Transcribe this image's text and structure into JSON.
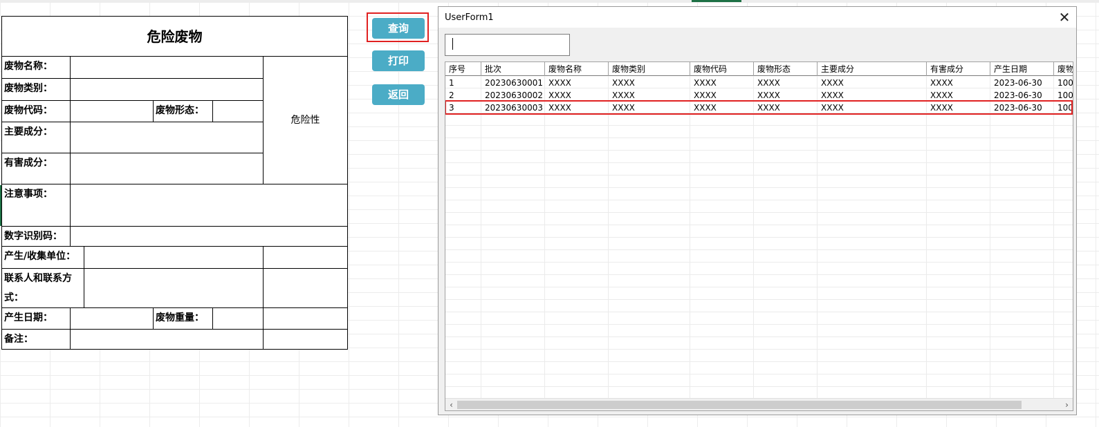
{
  "label_form": {
    "title": "危险废物",
    "rows": {
      "name_label": "废物名称：",
      "category_label": "废物类别：",
      "code_label": "废物代码：",
      "form_label": "废物形态：",
      "main_component_label": "主要成分：",
      "harmful_component_label": "有害成分：",
      "hazard_label": "危险性",
      "notes_label": "注意事项：",
      "digital_id_label": "数字识别码：",
      "producer_label": "产生/收集单位：",
      "contact_label": "联系人和联系方式：",
      "date_label": "产生日期：",
      "weight_label": "废物重量：",
      "remark_label": "备注："
    }
  },
  "buttons": {
    "query": "查询",
    "print": "打印",
    "back": "返回",
    "highlight_color": "#e02020",
    "button_color": "#4bacc6"
  },
  "userform": {
    "title": "UserForm1",
    "close_symbol": "✕",
    "search_value": "",
    "columns": [
      "序号",
      "批次",
      "废物名称",
      "废物类别",
      "废物代码",
      "废物形态",
      "主要成分",
      "有害成分",
      "产生日期",
      "废物"
    ],
    "rows": [
      [
        "1",
        "20230630001",
        "XXXX",
        "XXXX",
        "XXXX",
        "XXXX",
        "XXXX",
        "XXXX",
        "2023-06-30",
        "100"
      ],
      [
        "2",
        "20230630002",
        "XXXX",
        "XXXX",
        "XXXX",
        "XXXX",
        "XXXX",
        "XXXX",
        "2023-06-30",
        "100"
      ],
      [
        "3",
        "20230630003",
        "XXXX",
        "XXXX",
        "XXXX",
        "XXXX",
        "XXXX",
        "XXXX",
        "2023-06-30",
        "100"
      ]
    ],
    "selected_row": 3,
    "scroll_left_icon": "‹",
    "scroll_right_icon": "›"
  }
}
